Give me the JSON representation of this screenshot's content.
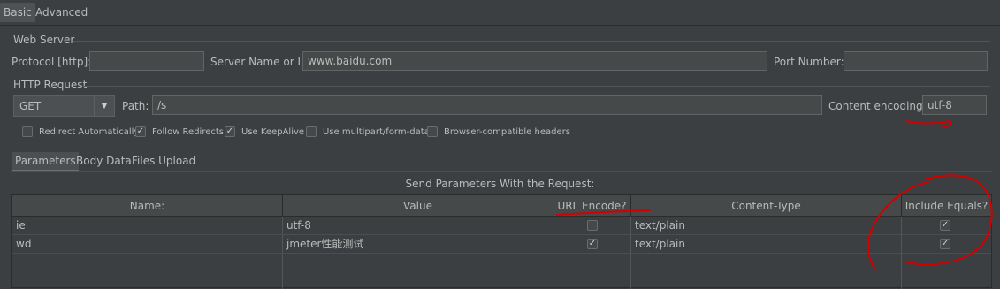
{
  "tabs": {
    "basic": "Basic",
    "advanced": "Advanced"
  },
  "web_server": {
    "title": "Web Server",
    "protocol_label": "Protocol [http]:",
    "protocol_value": "",
    "server_label": "Server Name or IP:",
    "server_value": "www.baidu.com",
    "port_label": "Port Number:",
    "port_value": ""
  },
  "http_request": {
    "title": "HTTP Request",
    "method": "GET",
    "path_label": "Path:",
    "path_value": "/s",
    "encoding_label": "Content encoding:",
    "encoding_value": "utf-8",
    "options": [
      {
        "label": "Redirect Automatically",
        "checked": false
      },
      {
        "label": "Follow Redirects",
        "checked": true
      },
      {
        "label": "Use KeepAlive",
        "checked": true
      },
      {
        "label": "Use multipart/form-data",
        "checked": false
      },
      {
        "label": "Browser-compatible headers",
        "checked": false
      }
    ]
  },
  "subtabs": {
    "parameters": "Parameters",
    "body": "Body Data",
    "files": "Files Upload"
  },
  "params": {
    "caption": "Send Parameters With the Request:",
    "columns": [
      "Name:",
      "Value",
      "URL Encode?",
      "Content-Type",
      "Include Equals?"
    ],
    "rows": [
      {
        "name": "ie",
        "value": "utf-8",
        "encode": false,
        "type": "text/plain",
        "equals": true
      },
      {
        "name": "wd",
        "value": "jmeter性能测试",
        "encode": true,
        "type": "text/plain",
        "equals": true
      }
    ]
  },
  "icons": {
    "dropdown": "triangle-down-icon",
    "check": "checkmark-icon"
  },
  "colors": {
    "background": "#3c3f41",
    "field": "#45494a",
    "annotation": "#d40000"
  }
}
